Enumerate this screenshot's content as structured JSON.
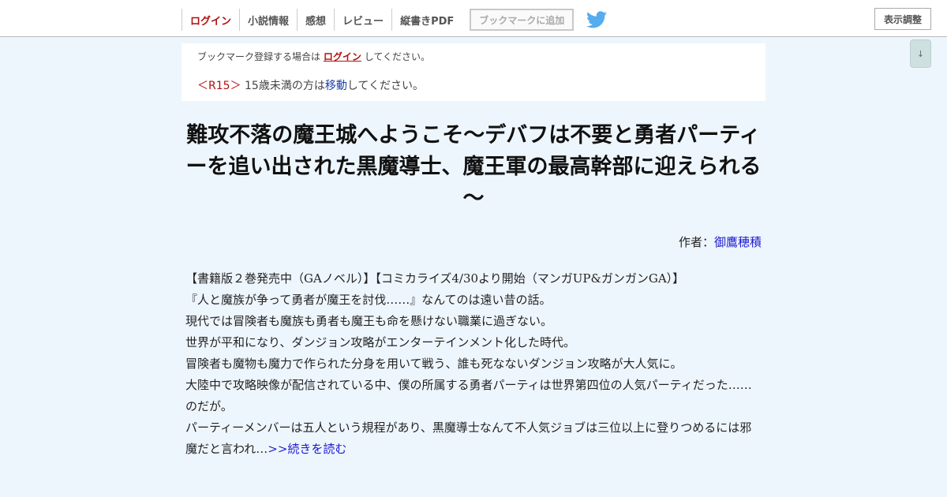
{
  "header": {
    "nav": {
      "login": "ログイン",
      "novel_info": "小説情報",
      "impressions": "感想",
      "review": "レビュー",
      "vertical_pdf": "縦書きPDF",
      "add_bookmark": "ブックマークに追加"
    },
    "display_settings": "表示調整",
    "scroll_down": "↓"
  },
  "notice": {
    "bookmark_prefix": "ブックマーク登録する場合は",
    "bookmark_login": "ログイン",
    "bookmark_suffix": "してください。",
    "r15_tag": "＜R15＞",
    "r15_prefix": "15歳未満の方は",
    "r15_link": "移動",
    "r15_suffix": "してください。"
  },
  "novel": {
    "title": "難攻不落の魔王城へようこそ～デバフは不要と勇者パーティーを追い出された黒魔導士、魔王軍の最高幹部に迎えられる～",
    "author_label": "作者：",
    "author_name": "御鷹穂積",
    "synopsis": [
      "【書籍版２巻発売中（GAノベル）】【コミカライズ4/30より開始（マンガUP&ガンガンGA）】",
      "『人と魔族が争って勇者が魔王を討伐……』なんてのは遠い昔の話。",
      "現代では冒険者も魔族も勇者も魔王も命を懸けない職業に過ぎない。",
      "世界が平和になり、ダンジョン攻略がエンターテインメント化した時代。",
      "冒険者も魔物も魔力で作られた分身を用いて戦う、誰も死なないダンジョン攻略が大人気に。",
      "大陸中で攻略映像が配信されている中、僕の所属する勇者パーティは世界第四位の人気パーティだった……のだが。"
    ],
    "synopsis_last": "パーティーメンバーは五人という規程があり、黒魔導士なんて不人気ジョブは三位以上に登りつめるには邪魔だと言われ…",
    "read_more": ">>続きを読む"
  },
  "colors": {
    "background": "#eef6fd",
    "login_red": "#b01010",
    "link_blue": "#1a1acc",
    "twitter_blue": "#55acee"
  }
}
